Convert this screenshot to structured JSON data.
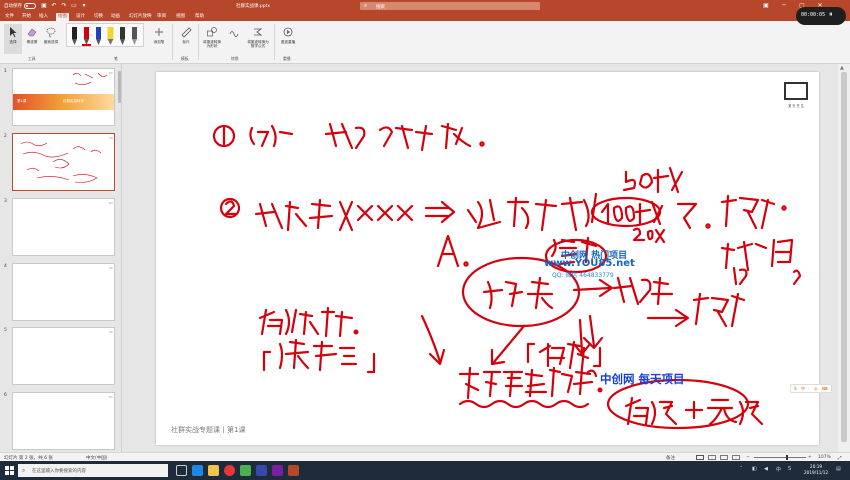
{
  "titlebar": {
    "autosave": "自动保存",
    "doc_title": "社群实战课.pptx",
    "search_placeholder": "搜索"
  },
  "tabs": [
    "文件",
    "开始",
    "插入",
    "绘图",
    "设计",
    "切换",
    "动画",
    "幻灯片放映",
    "审阅",
    "视图",
    "帮助"
  ],
  "active_tab": "绘图",
  "ribbon": {
    "select_label": "选择",
    "eraser_label": "橡皮擦",
    "lasso_label": "套索选择",
    "add_pen_label": "添加笔",
    "ruler_label": "标尺",
    "ink_to_shape_label": "将墨迹转换为形状",
    "ink_to_math_label": "将墨迹转换为数学公式",
    "ink_replay_label": "墨迹重播",
    "groups": [
      "工具",
      "笔",
      "模板",
      "转换",
      "重播"
    ]
  },
  "recording": {
    "time": "00:00:05"
  },
  "slides": [
    {
      "number": "1",
      "banner_left": "第1课",
      "banner_right": "社群实战特训"
    },
    {
      "number": "2"
    },
    {
      "number": "3"
    },
    {
      "number": "4"
    },
    {
      "number": "5"
    },
    {
      "number": "6"
    }
  ],
  "slide": {
    "footer": "社群实战专题课丨第1课",
    "logo_text": "某 天 先 生",
    "watermark_1": "中创网 热门项目",
    "watermark_2": "www.YOU85.net",
    "watermark_3": "QQ: 微信 464833779",
    "watermark_4": "中创网 每天项目"
  },
  "side_widget": [
    "S",
    "中",
    "·",
    "◎",
    "⌨"
  ],
  "statusbar": {
    "slide_info": "幻灯片 第 2 张，共 6 张",
    "language": "中文(中国)",
    "notes": "备注",
    "zoom": "107%"
  },
  "taskbar": {
    "search_placeholder": "在这里输入你要搜索的内容",
    "clock_time": "20:19",
    "clock_date": "2019/11/12"
  },
  "colors": {
    "accent": "#b7472a",
    "ink_red": "#d4000c",
    "selected_border": "#c5462b"
  }
}
